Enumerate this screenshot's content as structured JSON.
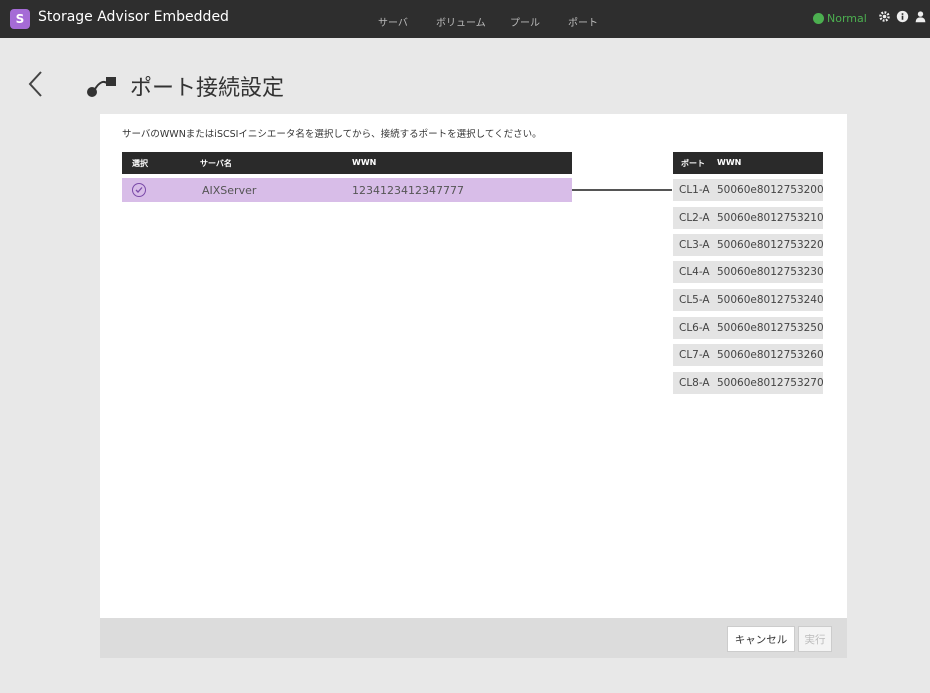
{
  "app": {
    "title": "Storage Advisor Embedded",
    "logo_glyph": "S"
  },
  "nav": [
    "サーバ",
    "ボリューム",
    "プール",
    "ポート"
  ],
  "status": {
    "text": "Normal",
    "color": "#4caf50"
  },
  "top_icons": [
    "gear-icon",
    "info-icon",
    "user-icon"
  ],
  "page": {
    "title": "ポート接続設定",
    "instruction": "サーバのWWNまたはiSCSIイニシエータ名を選択してから、接続するポートを選択してください。"
  },
  "server_table": {
    "headers": {
      "select": "選択",
      "server_name": "サーバ名",
      "wwn": "WWN"
    },
    "rows": [
      {
        "server_name": "AIXServer",
        "wwn": "1234123412347777",
        "selected": true
      }
    ]
  },
  "port_table": {
    "headers": {
      "port": "ポート",
      "wwn": "WWN"
    },
    "rows": [
      {
        "port": "CL1-A",
        "wwn": "50060e8012753200"
      },
      {
        "port": "CL2-A",
        "wwn": "50060e8012753210"
      },
      {
        "port": "CL3-A",
        "wwn": "50060e8012753220"
      },
      {
        "port": "CL4-A",
        "wwn": "50060e8012753230"
      },
      {
        "port": "CL5-A",
        "wwn": "50060e8012753240"
      },
      {
        "port": "CL6-A",
        "wwn": "50060e8012753250"
      },
      {
        "port": "CL7-A",
        "wwn": "50060e8012753260"
      },
      {
        "port": "CL8-A",
        "wwn": "50060e8012753270"
      }
    ]
  },
  "footer": {
    "cancel_label": "キャンセル",
    "execute_label": "実行"
  }
}
